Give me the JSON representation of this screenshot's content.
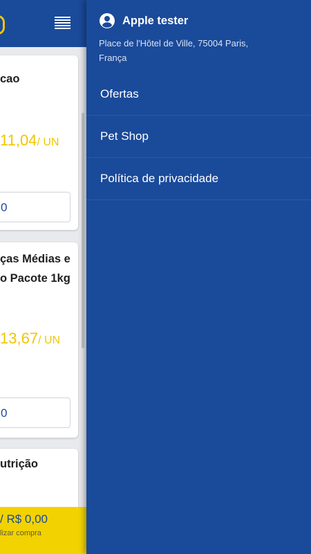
{
  "background_app": {
    "cards": [
      {
        "title": "cao",
        "price": "11,04",
        "unit": "/ UN",
        "field": "0"
      },
      {
        "title_lines": [
          "ças Médias e",
          "o Pacote 1kg"
        ],
        "price": "13,67",
        "unit": "/ UN",
        "field": "0"
      },
      {
        "title": "utrição"
      }
    ],
    "cart": {
      "total": "/ R$ 0,00",
      "hint": "lizar compra"
    }
  },
  "drawer": {
    "user": {
      "name": "Apple tester",
      "icon": "account-circle-icon"
    },
    "address": "Place de l'Hôtel de Ville, 75004 Paris, França",
    "menu": [
      {
        "label": "Ofertas"
      },
      {
        "label": "Pet Shop"
      },
      {
        "label": "Política de privacidade"
      }
    ]
  },
  "colors": {
    "primary": "#1a4a9a",
    "accent_yellow": "#f2c500",
    "cart_bar": "#f2d200",
    "background": "#e9eaee"
  }
}
